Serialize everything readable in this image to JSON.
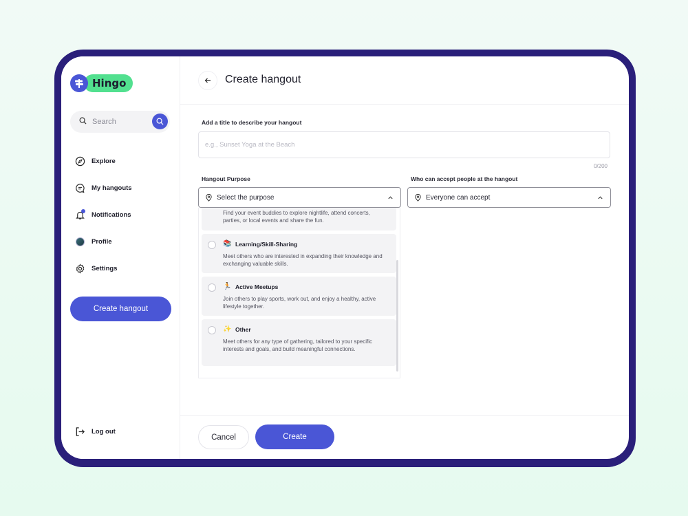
{
  "app": {
    "logo_text": "Hingo"
  },
  "colors": {
    "accent": "#4a56d6",
    "brand_green": "#52e08f",
    "device_frame": "#2a1f7a"
  },
  "sidebar": {
    "search_placeholder": "Search",
    "items": [
      {
        "label": "Explore",
        "icon": "compass-icon"
      },
      {
        "label": "My hangouts",
        "icon": "chat-icon"
      },
      {
        "label": "Notifications",
        "icon": "bell-icon"
      },
      {
        "label": "Profile",
        "icon": "avatar-icon"
      },
      {
        "label": "Settings",
        "icon": "gear-icon"
      }
    ],
    "create_button": "Create hangout",
    "logout": "Log out"
  },
  "header": {
    "title": "Create hangout"
  },
  "form": {
    "title_label": "Add a title to describe your hangout",
    "title_placeholder": "e.g., Sunset Yoga at the Beach",
    "title_counter": "0/200",
    "purpose_label": "Hangout Purpose",
    "purpose_value": "Select the purpose",
    "accept_label": "Who can accept people at the hangout",
    "accept_value": "Everyone can accept"
  },
  "purpose_options": [
    {
      "title": "",
      "emoji": "",
      "description": "Find your event buddies to explore nightlife, attend concerts,  parties, or local events and share the fun."
    },
    {
      "title": "Learning/Skill-Sharing",
      "emoji": "📚",
      "description": "Meet others who are interested in expanding their knowledge and exchanging valuable skills."
    },
    {
      "title": "Active Meetups",
      "emoji": "🏃",
      "description": "Join others to play sports, work out, and enjoy a healthy, active lifestyle together."
    },
    {
      "title": "Other",
      "emoji": "✨",
      "description": "Meet others for any type of gathering, tailored to your specific interests and goals, and build meaningful connections."
    }
  ],
  "footer": {
    "cancel": "Cancel",
    "create": "Create"
  }
}
